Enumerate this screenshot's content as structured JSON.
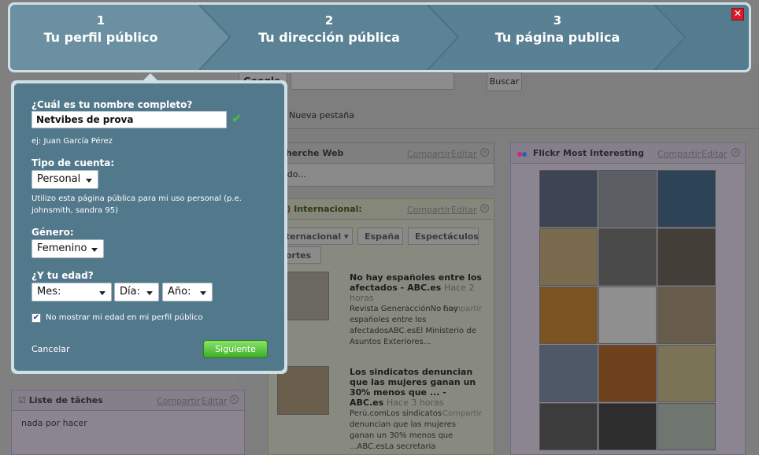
{
  "wizard": {
    "steps": [
      {
        "number": "1",
        "label": "Tu perfil público",
        "active": true
      },
      {
        "number": "2",
        "label": "Tu dirección pública",
        "active": false
      },
      {
        "number": "3",
        "label": "Tu página publica",
        "active": false
      }
    ],
    "close_label": "✕"
  },
  "form": {
    "name_label": "¿Cuál es tu nombre completo?",
    "name_value": "Netvibes de prova",
    "name_hint": "ej: Juan García Pérez",
    "account_label": "Tipo de cuenta:",
    "account_value": "Personal",
    "account_hint": "Utilizo esta página pública para mi uso personal (p.e. johnsmith, sandra 95)",
    "gender_label": "Género:",
    "gender_value": "Femenino",
    "age_label": "¿Y tu edad?",
    "month_value": "Mes:",
    "day_value": "Día:",
    "year_value": "Año:",
    "hide_age_label": "No mostrar mi edad en mi perfil público",
    "hide_age_checked": true,
    "cancel_label": "Cancelar",
    "next_label": "Siguiente"
  },
  "background": {
    "search_label": "Google",
    "search_button": "Buscar",
    "new_tab": "Nueva pestaña",
    "share": "Compartir",
    "edit": "Editar",
    "recherche": {
      "title": "echerche Web",
      "body": "ando..."
    },
    "internacional": {
      "count": "01)",
      "title": "Internacional:",
      "tabs": [
        "nternacional",
        "España",
        "Espectáculos",
        "portes"
      ],
      "items": [
        {
          "title": "No hay españoles entre los afectados - ABC.es",
          "age": "Hace 2 horas",
          "text": "Revista GeneracciónNo hay españoles entre los afectadosABC.esEl Ministerio de Asuntos Exteriores..."
        },
        {
          "title": "Los sindicatos denuncian que las mujeres ganan un 30% menos que ... - ABC.es",
          "age": "Hace 3 horas",
          "text": "Perú.comLos sindicatos denuncian que las mujeres ganan un 30% menos que ...ABC.esLa secretaria"
        }
      ]
    },
    "flickr": {
      "title": "Flickr Most Interesting"
    },
    "taches": {
      "title": "Liste de tâches",
      "body": "nada por hacer"
    }
  },
  "colors": {
    "wizard_step": "#5f8597",
    "panel_bg": "#52788b",
    "next_button": "#3cad27",
    "check_green": "#3fc53c",
    "close_red": "#d5202a"
  }
}
